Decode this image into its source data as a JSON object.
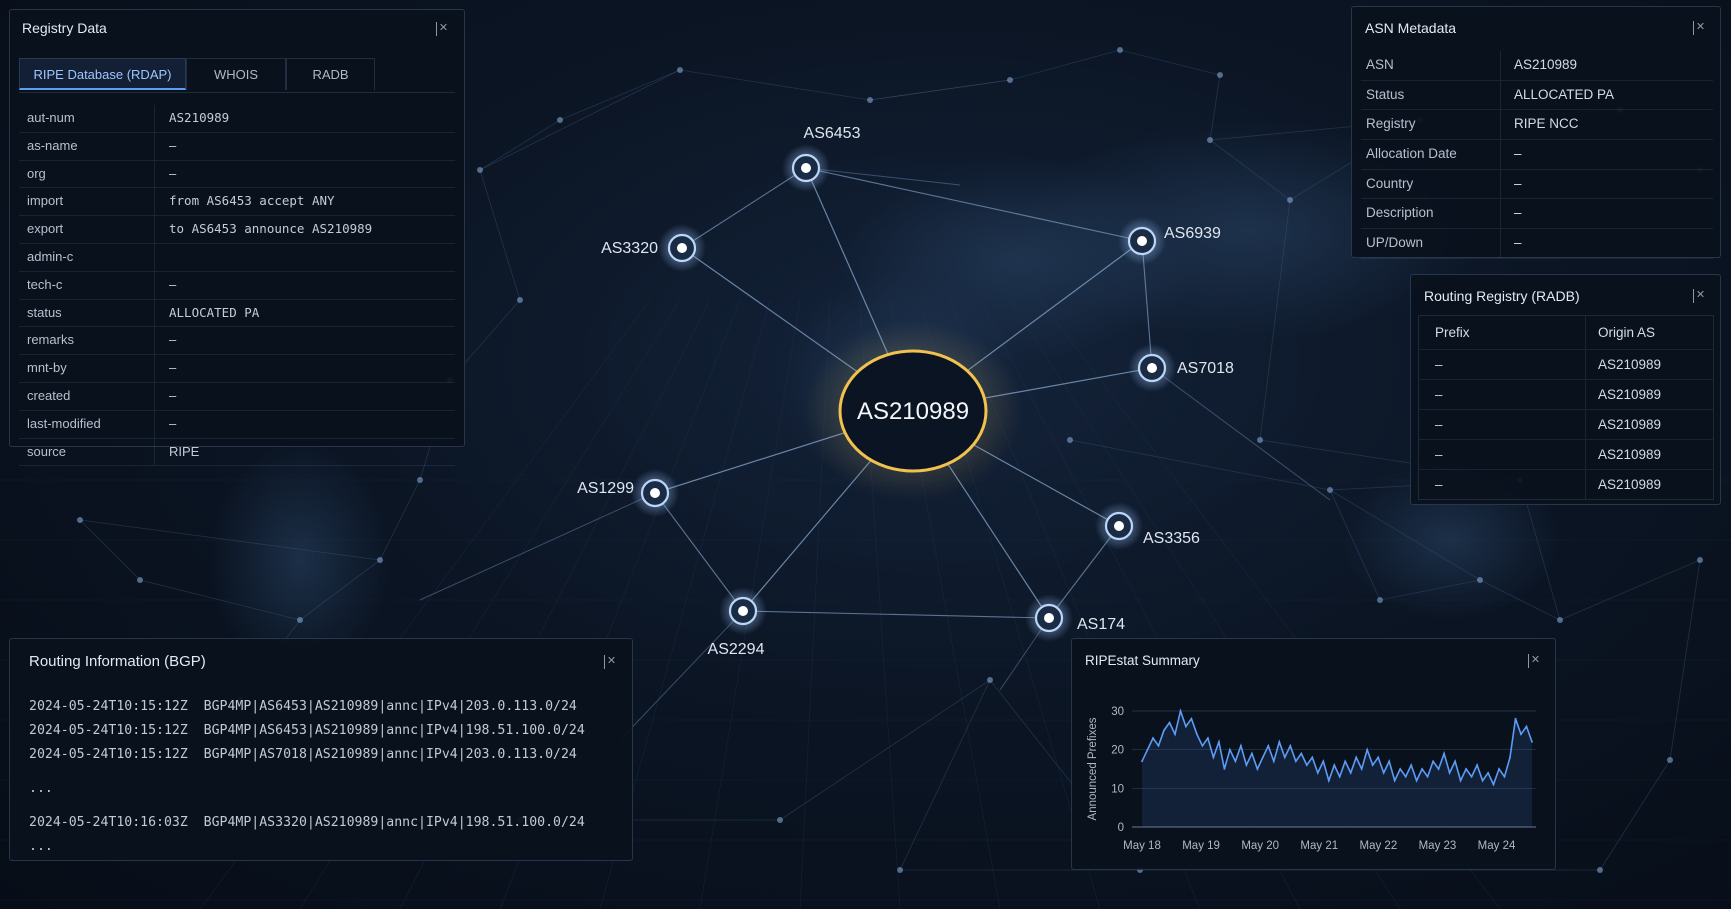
{
  "registry": {
    "title": "Registry Data",
    "tabs": [
      "RIPE Database (RDAP)",
      "WHOIS",
      "RADB"
    ],
    "rows": [
      {
        "key": "aut-num",
        "value": "AS210989"
      },
      {
        "key": "as-name",
        "value": "–"
      },
      {
        "key": "org",
        "value": "–"
      },
      {
        "key": "import",
        "value": "from AS6453 accept ANY"
      },
      {
        "key": "export",
        "value": "to AS6453 announce AS210989"
      },
      {
        "key": "admin-c",
        "value": ""
      },
      {
        "key": "tech-c",
        "value": "–"
      },
      {
        "key": "status",
        "value": "ALLOCATED PA"
      },
      {
        "key": "remarks",
        "value": "–"
      },
      {
        "key": "mnt-by",
        "value": "–"
      },
      {
        "key": "created",
        "value": "–"
      },
      {
        "key": "last-modified",
        "value": "–"
      },
      {
        "key": "source",
        "value": "RIPE"
      }
    ]
  },
  "asn_meta": {
    "title": "ASN Metadata",
    "rows": [
      {
        "key": "ASN",
        "value": "AS210989"
      },
      {
        "key": "Status",
        "value": "ALLOCATED PA"
      },
      {
        "key": "Registry",
        "value": "RIPE NCC"
      },
      {
        "key": "Allocation Date",
        "value": "–"
      },
      {
        "key": "Country",
        "value": "–"
      },
      {
        "key": "Description",
        "value": "–"
      },
      {
        "key": "UP/Down",
        "value": "–"
      }
    ]
  },
  "radb": {
    "title": "Routing Registry (RADB)",
    "headers": [
      "Prefix",
      "Origin AS"
    ],
    "rows": [
      [
        "–",
        "AS210989"
      ],
      [
        "–",
        "AS210989"
      ],
      [
        "–",
        "AS210989"
      ],
      [
        "–",
        "AS210989"
      ],
      [
        "–",
        "AS210989"
      ]
    ]
  },
  "bgp": {
    "title": "Routing Information (BGP)",
    "lines": [
      "2024-05-24T10:15:12Z  BGP4MP|AS6453|AS210989|annc|IPv4|203.0.113.0/24",
      "2024-05-24T10:15:12Z  BGP4MP|AS6453|AS210989|annc|IPv4|198.51.100.0/24",
      "2024-05-24T10:15:12Z  BGP4MP|AS7018|AS210989|annc|IPv4|203.0.113.0/24",
      "...",
      "2024-05-24T10:16:03Z  BGP4MP|AS3320|AS210989|annc|IPv4|198.51.100.0/24",
      "..."
    ]
  },
  "graph": {
    "center": "AS210989",
    "peers": [
      "AS6453",
      "AS3320",
      "AS6939",
      "AS7018",
      "AS1299",
      "AS3356",
      "AS2294",
      "AS174"
    ]
  },
  "ripestat": {
    "title": "RIPEstat Summary"
  },
  "colors": {
    "accent": "#5c9cf5",
    "center_ring": "#f2c14e",
    "line": "#5f7fa8"
  },
  "chart_data": {
    "type": "line",
    "ylabel": "Announced Prefixes",
    "xlabel": "",
    "ylim": [
      0,
      30
    ],
    "yticks": [
      0,
      10,
      20,
      30
    ],
    "xticks": [
      "May 18",
      "May 19",
      "May 20",
      "May 21",
      "May 22",
      "May 23",
      "May 24"
    ],
    "x_range_days": [
      0,
      6.6
    ],
    "series": [
      {
        "values": [
          17,
          20,
          23,
          21,
          25,
          27,
          24,
          30,
          26,
          28,
          24,
          21,
          23,
          18,
          22,
          15,
          20,
          17,
          21,
          16,
          19,
          15,
          18,
          21,
          17,
          22,
          18,
          21,
          17,
          19,
          16,
          18,
          14,
          17,
          12,
          16,
          13,
          17,
          14,
          18,
          15,
          20,
          16,
          18,
          14,
          17,
          12,
          15,
          13,
          16,
          12,
          15,
          13,
          17,
          15,
          19,
          14,
          17,
          12,
          15,
          13,
          16,
          12,
          14,
          11,
          15,
          13,
          18,
          28,
          24,
          26,
          22
        ]
      }
    ],
    "grid": true
  }
}
